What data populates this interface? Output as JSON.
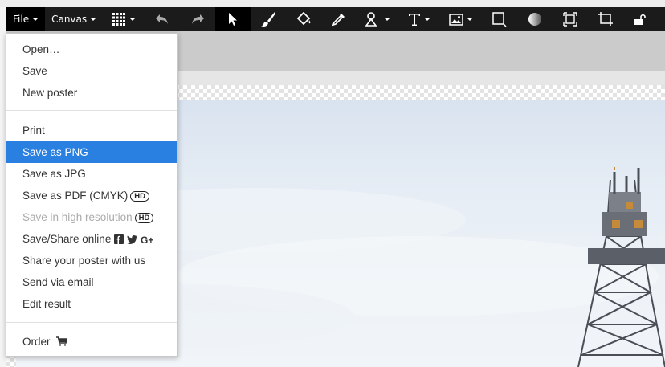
{
  "toolbar": {
    "file_label": "File",
    "canvas_label": "Canvas",
    "buttons": [
      "grid-icon",
      "undo-icon",
      "redo-icon",
      "pointer-icon",
      "brush-icon",
      "fill-bucket-icon",
      "eyedropper-icon",
      "shapes-icon",
      "text-tool-icon",
      "image-icon",
      "border-icon",
      "gradient-icon",
      "fit-canvas-icon",
      "crop-icon",
      "lock-icon"
    ]
  },
  "file_menu": {
    "items": [
      {
        "label": "Open…"
      },
      {
        "label": "Save"
      },
      {
        "label": "New poster"
      },
      {
        "label": "Print"
      },
      {
        "label": "Save as PNG"
      },
      {
        "label": "Save as JPG"
      },
      {
        "label": "Save as PDF (CMYK)",
        "badge": "HD"
      },
      {
        "label": "Save in high resolution",
        "badge": "HD"
      },
      {
        "label": "Save/Share online"
      },
      {
        "label": "Share your poster with us"
      },
      {
        "label": "Send via email"
      },
      {
        "label": "Edit result"
      },
      {
        "label": "Order"
      }
    ]
  },
  "colors": {
    "highlight": "#2a80e0",
    "toolbar": "#1b1b1b",
    "disabled": "#aaaaaa"
  }
}
